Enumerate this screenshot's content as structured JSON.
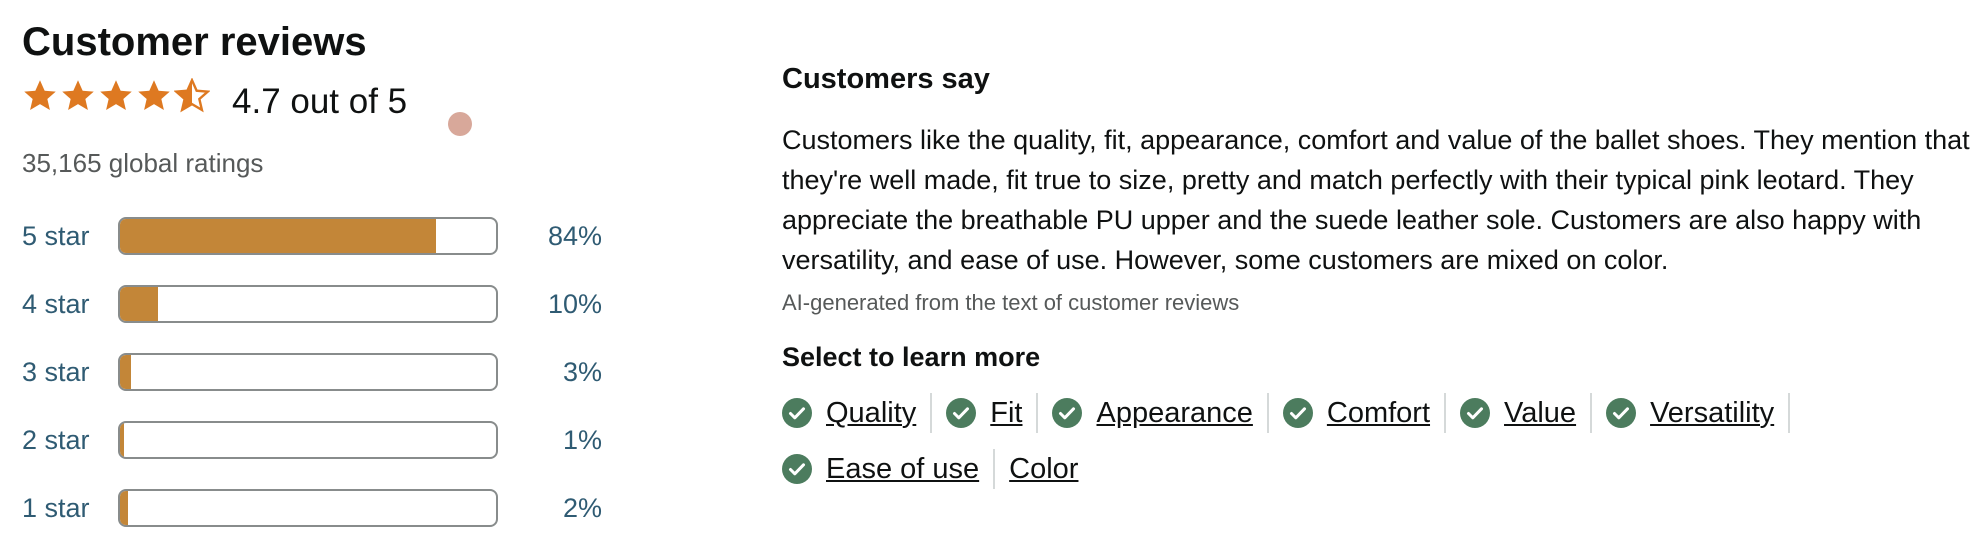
{
  "colors": {
    "star": "#de7921",
    "bar_fill": "#c38638",
    "link": "#2f5b73",
    "check": "#4c7c5e",
    "dot": "#d8a89a"
  },
  "left": {
    "title": "Customer reviews",
    "stars_icon": "4.5 stars",
    "rating_text": "4.7 out of 5",
    "rating_value": 4.7,
    "global_ratings": "35,165 global ratings",
    "histogram": [
      {
        "label": "5 star",
        "percent_text": "84%",
        "value": 84
      },
      {
        "label": "4 star",
        "percent_text": "10%",
        "value": 10
      },
      {
        "label": "3 star",
        "percent_text": "3%",
        "value": 3
      },
      {
        "label": "2 star",
        "percent_text": "1%",
        "value": 1
      },
      {
        "label": "1 star",
        "percent_text": "2%",
        "value": 2
      }
    ]
  },
  "right": {
    "title": "Customers say",
    "summary": "Customers like the quality, fit, appearance, comfort and value of the ballet shoes. They mention that they're well made, fit true to size, pretty and match perfectly with their typical pink leotard. They appreciate the breathable PU upper and the suede leather sole. Customers are also happy with versatility, and ease of use. However, some customers are mixed on color.",
    "ai_note": "AI-generated from the text of customer reviews",
    "select_title": "Select to learn more",
    "aspects": [
      {
        "label": "Quality",
        "positive": true
      },
      {
        "label": "Fit",
        "positive": true
      },
      {
        "label": "Appearance",
        "positive": true
      },
      {
        "label": "Comfort",
        "positive": true
      },
      {
        "label": "Value",
        "positive": true
      },
      {
        "label": "Versatility",
        "positive": true
      },
      {
        "label": "Ease of use",
        "positive": true
      },
      {
        "label": "Color",
        "positive": false
      }
    ]
  }
}
